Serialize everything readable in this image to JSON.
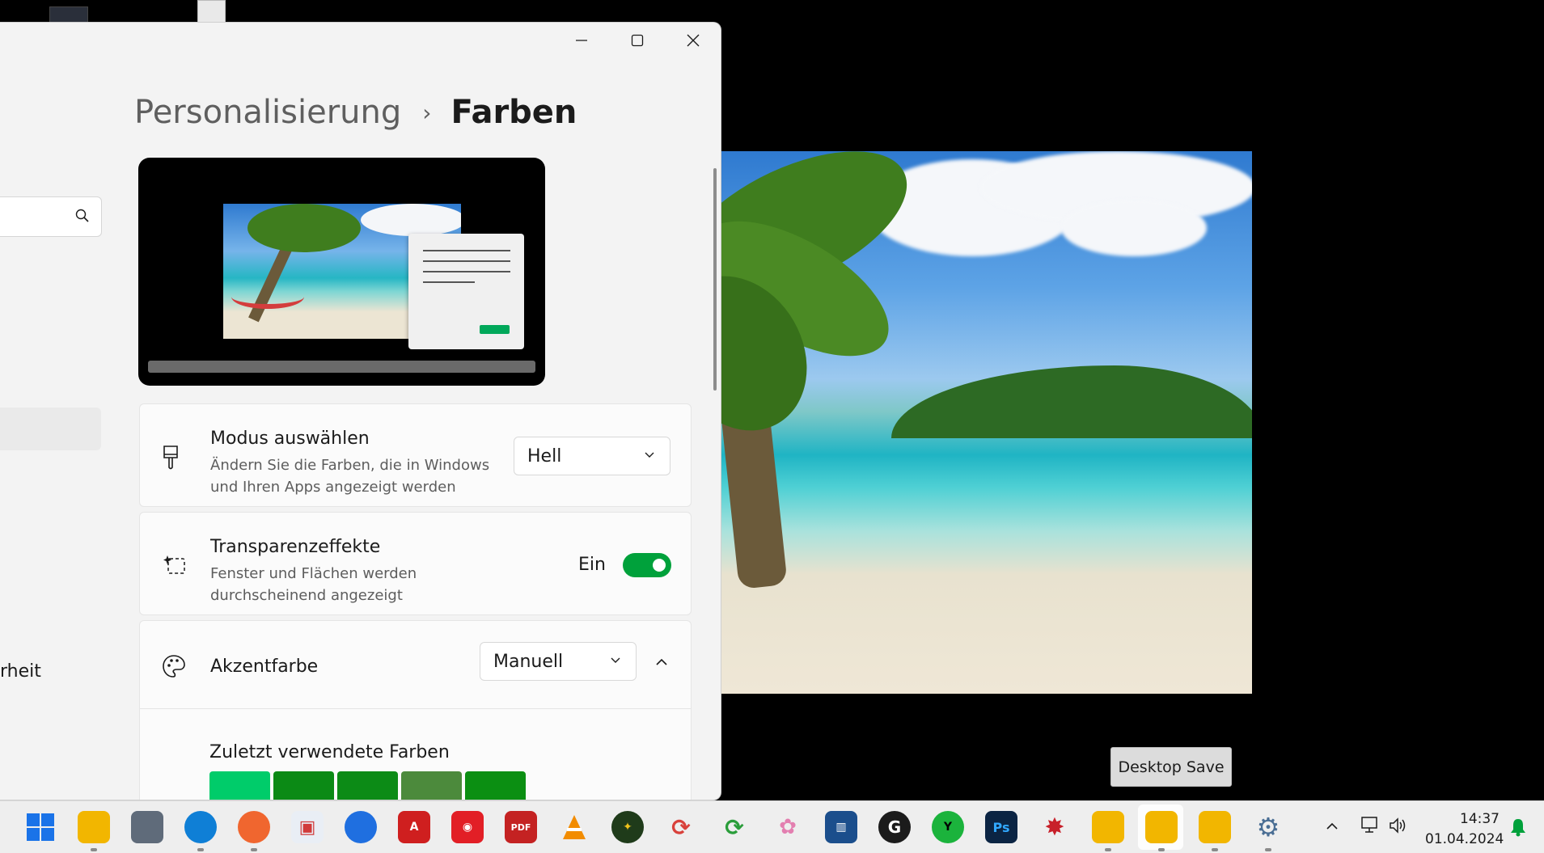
{
  "window": {
    "breadcrumb_parent": "Personalisierung",
    "breadcrumb_separator": "›",
    "breadcrumb_current": "Farben",
    "nav_partial_label": "rheit"
  },
  "mode_card": {
    "title": "Modus auswählen",
    "subtitle": "Ändern Sie die Farben, die in Windows und Ihren Apps angezeigt werden",
    "value": "Hell"
  },
  "transparency_card": {
    "title": "Transparenzeffekte",
    "subtitle": "Fenster und Flächen werden durchscheinend angezeigt",
    "state_label": "Ein",
    "on": true
  },
  "accent_card": {
    "title": "Akzentfarbe",
    "value": "Manuell",
    "recent_title": "Zuletzt verwendete Farben",
    "recent_colors": [
      "#00cc6a",
      "#0b8a15",
      "#0c8b16",
      "#4c8a3c",
      "#0b8f12"
    ]
  },
  "desktop": {
    "save_button": "Desktop Save"
  },
  "taskbar": {
    "time": "14:37",
    "date": "01.04.2024"
  },
  "colors": {
    "accent": "#00a13b",
    "window_bg": "#f3f3f3"
  }
}
